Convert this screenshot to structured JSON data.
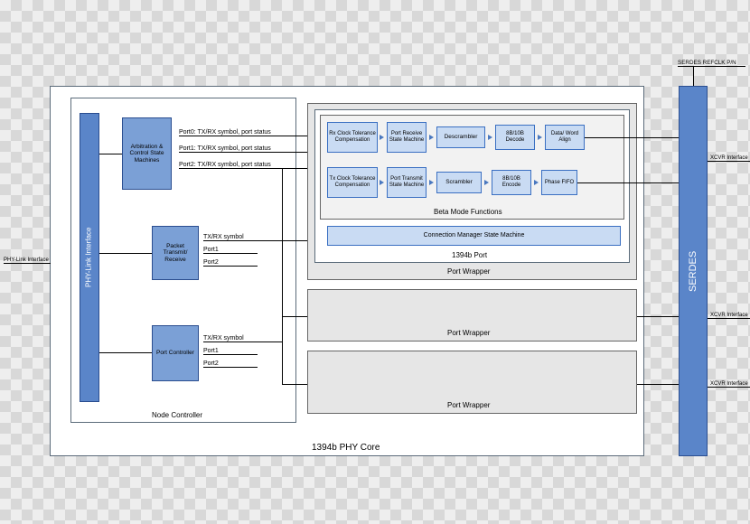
{
  "phy_core": {
    "title": "1394b PHY Core"
  },
  "node_controller": {
    "title": "Node Controller"
  },
  "phy_link_interface": {
    "label": "PHY-Link Interface",
    "ext_label": "PHY-Link Interface"
  },
  "arb": {
    "label": "Arbitration & Control State Machines",
    "ports": [
      "Port0: TX/RX symbol, port status",
      "Port1: TX/RX symbol, port status",
      "Port2: TX/RX symbol, port status"
    ]
  },
  "ptr": {
    "label": "Packet Transmit/ Receive",
    "rows": [
      "TX/RX symbol",
      "Port1",
      "Port2"
    ]
  },
  "portctl": {
    "label": "Port Controller",
    "rows": [
      "TX/RX symbol",
      "Port1",
      "Port2"
    ]
  },
  "port_wrapper_label": "Port Wrapper",
  "port1394b_label": "1394b Port",
  "beta": {
    "title": "Beta Mode Functions",
    "rx": [
      "Rx Clock Tolerance Compensation",
      "Port Receive State Machine",
      "Descrambler",
      "8B/10B Decode",
      "Data/ Word Align"
    ],
    "tx": [
      "Tx Clock Tolerance Compensation",
      "Port Transmit State Machine",
      "Scrambler",
      "8B/10B Encode",
      "Phase FIFO"
    ]
  },
  "cmsm_label": "Connection Manager State Machine",
  "serdes": {
    "title": "SERDES",
    "refclk": "SERDES REFCLK P/N"
  },
  "xcvr_label": "XCVR Interface"
}
